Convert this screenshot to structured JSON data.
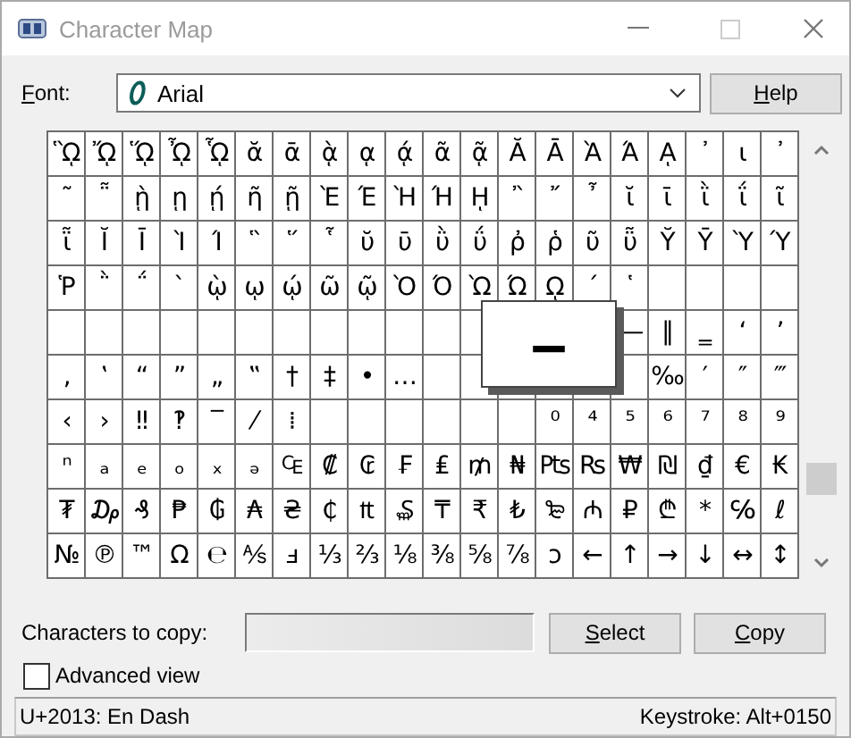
{
  "window": {
    "title": "Character Map"
  },
  "font": {
    "label": "Font:",
    "value": "Arial"
  },
  "help_button": {
    "label": "Help"
  },
  "grid": {
    "rows": [
      [
        "ᾫ",
        "ᾬ",
        "ᾭ",
        "ᾮ",
        "ᾯ",
        "ᾰ",
        "ᾱ",
        "ᾲ",
        "ᾳ",
        "ᾴ",
        "ᾶ",
        "ᾷ",
        "Ᾰ",
        "Ᾱ",
        "Ὰ",
        "Ά",
        "ᾼ",
        "᾽",
        "ι",
        "᾿"
      ],
      [
        "῀",
        "῁",
        "ῂ",
        "ῃ",
        "ῄ",
        "ῆ",
        "ῇ",
        "Ὲ",
        "Έ",
        "Ὴ",
        "Ή",
        "ῌ",
        "῍",
        "῎",
        "῏",
        "ῐ",
        "ῑ",
        "ῒ",
        "ΐ",
        "ῖ"
      ],
      [
        "ῗ",
        "Ῐ",
        "Ῑ",
        "Ὶ",
        "Ί",
        "῝",
        "῞",
        "῟",
        "ῠ",
        "ῡ",
        "ῢ",
        "ΰ",
        "ῤ",
        "ῥ",
        "ῦ",
        "ῧ",
        "Ῠ",
        "Ῡ",
        "Ὺ",
        "Ύ"
      ],
      [
        "Ῥ",
        "῭",
        "΅",
        "`",
        "ῲ",
        "ῳ",
        "ῴ",
        "ῶ",
        "ῷ",
        "Ὸ",
        "Ό",
        "Ὼ",
        "Ώ",
        "ῼ",
        "´",
        "῾",
        null,
        null,
        null,
        null
      ],
      [
        null,
        null,
        null,
        null,
        null,
        null,
        null,
        null,
        null,
        null,
        null,
        null,
        null,
        null,
        null,
        "―",
        "‖",
        "‗",
        "‘",
        "’"
      ],
      [
        "‚",
        "‛",
        "“",
        "”",
        "„",
        "‟",
        "†",
        "‡",
        "•",
        "…",
        null,
        null,
        null,
        null,
        null,
        null,
        "‰",
        "′",
        "″",
        "‴"
      ],
      [
        "‹",
        "›",
        "‼",
        "‽",
        "‾",
        "⁄",
        "⁞",
        null,
        null,
        null,
        null,
        null,
        null,
        "⁰",
        "⁴",
        "⁵",
        "⁶",
        "⁷",
        "⁸",
        "⁹"
      ],
      [
        "ⁿ",
        "ₐ",
        "ₑ",
        "ₒ",
        "ₓ",
        "ₔ",
        "₠",
        "₡",
        "₢",
        "₣",
        "₤",
        "₥",
        "₦",
        "₧",
        "₨",
        "₩",
        "₪",
        "₫",
        "€",
        "₭"
      ],
      [
        "₮",
        "₯",
        "₰",
        "₱",
        "₲",
        "₳",
        "₴",
        "₵",
        "₶",
        "₷",
        "₸",
        "₹",
        "₺",
        "₻",
        "₼",
        "₽",
        "₾",
        "*",
        "℅",
        "ℓ"
      ],
      [
        "№",
        "℗",
        "™",
        "Ω",
        "℮",
        "⅍",
        "ⅎ",
        "⅓",
        "⅔",
        "⅛",
        "⅜",
        "⅝",
        "⅞",
        "ↄ",
        "←",
        "↑",
        "→",
        "↓",
        "↔",
        "↕"
      ]
    ]
  },
  "magnifier": {
    "glyph": "–"
  },
  "copy": {
    "label": "Characters to copy:",
    "select_button": "Select",
    "copy_button": "Copy"
  },
  "advanced_view": {
    "label": "Advanced view",
    "checked": false
  },
  "status_bar": {
    "character": "U+2013: En Dash",
    "keystroke": "Keystroke: Alt+0150"
  }
}
